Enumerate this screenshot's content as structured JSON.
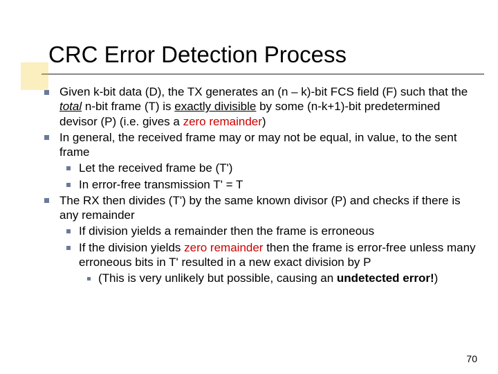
{
  "title": "CRC Error Detection Process",
  "bullets": {
    "b1_part1": "Given k-bit data (D), the TX generates an (n – k)-bit FCS field (F) such that the ",
    "b1_total": "total",
    "b1_part2": " n-bit frame (T) is ",
    "b1_exactly": "exactly divisible",
    "b1_part3": " by some (n-k+1)-bit predetermined devisor (P) (i.e. gives a ",
    "b1_zero": "zero remainder",
    "b1_part4": ")",
    "b2": "In general, the received frame may or may not be equal, in value, to the sent frame",
    "b2a": "Let the received frame be (T')",
    "b2b": "In error-free transmission T' = T",
    "b3": "The RX then divides (T') by the same known divisor (P) and checks if there is any remainder",
    "b3a": "If division yields a remainder then the frame is erroneous",
    "b3b_part1": "If the division yields ",
    "b3b_zero": "zero remainder",
    "b3b_part2": " then the frame is error-free unless many erroneous bits in T' resulted in a new exact division by P",
    "b3b_i_part1": "(This is very unlikely but possible, causing an ",
    "b3b_i_bold": "undetected error!",
    "b3b_i_part2": ")"
  },
  "pageNumber": "70"
}
